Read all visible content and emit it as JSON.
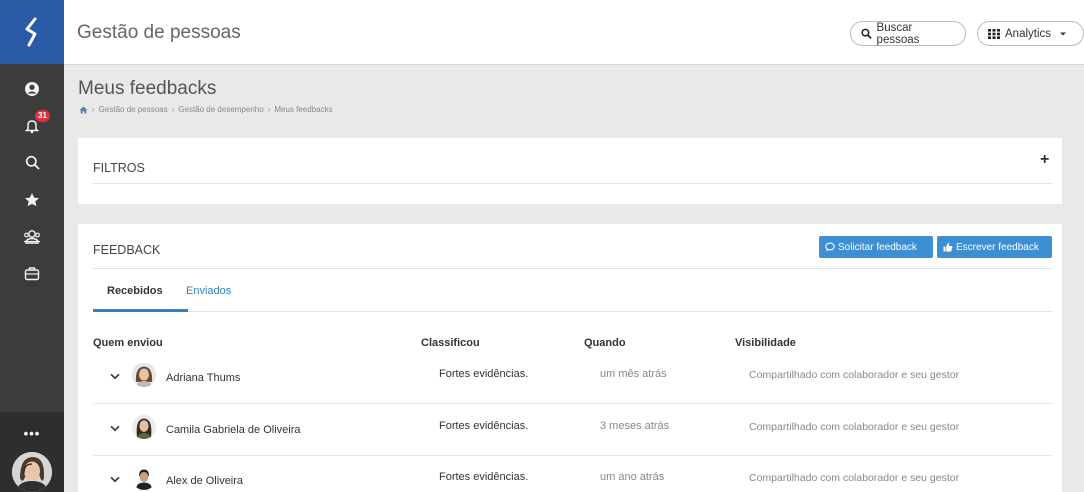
{
  "app": {
    "title": "Gestão de pessoas"
  },
  "topbar": {
    "search_label": "Buscar pessoas",
    "analytics_label": "Analytics"
  },
  "sidebar": {
    "notifications_count": "31",
    "more_label": "•••",
    "items": [
      "user-circle-icon",
      "bell-icon",
      "search-icon",
      "star-icon",
      "people-icon",
      "briefcase-icon"
    ]
  },
  "page": {
    "title": "Meus feedbacks",
    "breadcrumb": [
      "Gestão de pessoas",
      "Gestão de desempenho",
      "Meus feedbacks"
    ]
  },
  "filters": {
    "title": "FILTROS",
    "toggle": "+"
  },
  "feedback": {
    "title": "FEEDBACK",
    "request_button": "Solicitar feedback",
    "write_button": "Escrever feedback",
    "tabs": [
      {
        "label": "Recebidos",
        "active": true
      },
      {
        "label": "Enviados",
        "active": false
      }
    ],
    "columns": [
      "Quem enviou",
      "Classificou",
      "Quando",
      "Visibilidade"
    ],
    "rows": [
      {
        "name": "Adriana Thums",
        "classification": "Fortes evidências.",
        "when": "um mês atrás",
        "visibility": "Compartilhado com colaborador e seu gestor"
      },
      {
        "name": "Camila Gabriela de Oliveira",
        "classification": "Fortes evidências.",
        "when": "3 meses atrás",
        "visibility": "Compartilhado com colaborador e seu gestor"
      },
      {
        "name": "Alex de Oliveira",
        "classification": "Fortes evidências.",
        "when": "um ano atrás",
        "visibility": "Compartilhado com colaborador e seu gestor"
      }
    ]
  },
  "colors": {
    "brand": "#2b5aa6",
    "sidebar": "#3c3c3c",
    "primary_button": "#3d8ed3",
    "link": "#2d83c8",
    "badge": "#d9333f"
  }
}
